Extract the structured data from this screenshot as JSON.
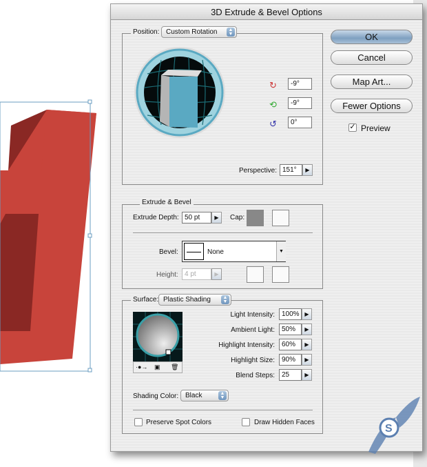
{
  "dialog": {
    "title": "3D Extrude & Bevel Options"
  },
  "buttons": {
    "ok": "OK",
    "cancel": "Cancel",
    "map_art": "Map Art...",
    "fewer_options": "Fewer Options",
    "preview": "Preview",
    "preview_checked": true
  },
  "position": {
    "label": "Position:",
    "value": "Custom Rotation",
    "rot_x": "-9°",
    "rot_y": "-9°",
    "rot_z": "0°",
    "perspective_label": "Perspective:",
    "perspective": "151°",
    "icons": [
      "rotate-x-axis-icon",
      "rotate-y-axis-icon",
      "rotate-z-axis-icon"
    ]
  },
  "extrude": {
    "legend": "Extrude & Bevel",
    "depth_label": "Extrude Depth:",
    "depth": "50 pt",
    "cap_label": "Cap:",
    "bevel_label": "Bevel:",
    "bevel": "None",
    "height_label": "Height:",
    "height": "4 pt"
  },
  "surface": {
    "label": "Surface:",
    "value": "Plastic Shading",
    "rows": [
      {
        "label": "Light Intensity:",
        "value": "100%"
      },
      {
        "label": "Ambient Light:",
        "value": "50%"
      },
      {
        "label": "Highlight Intensity:",
        "value": "60%"
      },
      {
        "label": "Highlight Size:",
        "value": "90%"
      },
      {
        "label": "Blend Steps:",
        "value": "25"
      }
    ],
    "shading_color_label": "Shading Color:",
    "shading_color": "Black",
    "preserve_spot": "Preserve Spot Colors",
    "draw_hidden": "Draw Hidden Faces"
  },
  "colors": {
    "cube_face": "#5aa9c2",
    "letter": "#c8403a",
    "accent": "#7fa0c0"
  }
}
